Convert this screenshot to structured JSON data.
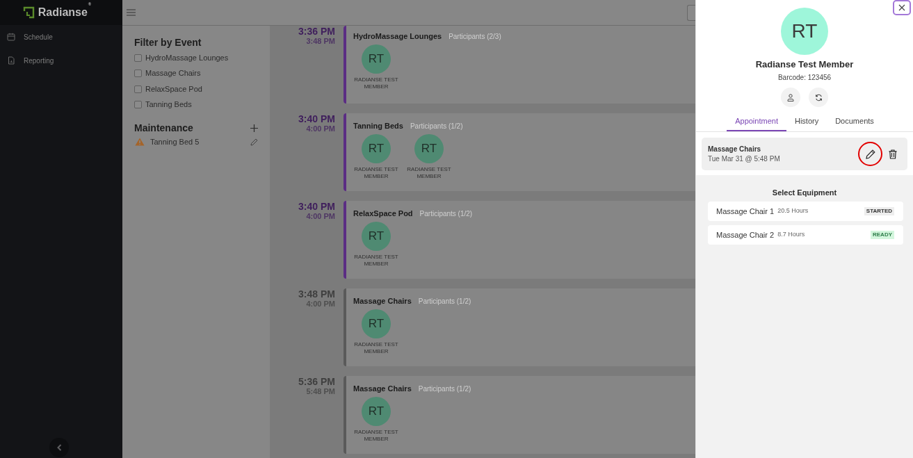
{
  "sidebar": {
    "logo": "Radianse$^{®}$",
    "items": [
      {
        "label": "Schedule",
        "selected": false
      },
      {
        "label": "Reporting",
        "selected": false
      }
    ]
  },
  "filter": {
    "title": "Filter by Event",
    "options": [
      {
        "label": "HydroMassage Lounges",
        "checked": false
      },
      {
        "label": "Massage Chairs",
        "checked": false
      },
      {
        "label": "RelaxSpace Pod",
        "checked": false
      },
      {
        "label": "Tanning Beds",
        "checked": false
      }
    ]
  },
  "maintenance": {
    "title": "Maintenance",
    "items": [
      {
        "label": "Tanning Bed 5"
      }
    ]
  },
  "schedule": [
    {
      "start": "3:36 PM",
      "end": "3:48 PM",
      "color": "#5b2d84",
      "title": "HydroMassage Lounges",
      "participants": "Participants (2/3)",
      "members": [
        {
          "initials": "RT",
          "name": "RADIANSE TEST MEMBER"
        }
      ]
    },
    {
      "start": "3:40 PM",
      "end": "4:00 PM",
      "color": "#5b2d84",
      "title": "Tanning Beds",
      "participants": "Participants (1/2)",
      "members": [
        {
          "initials": "RT",
          "name": "RADIANSE TEST MEMBER"
        },
        {
          "initials": "RT",
          "name": "RADIANSE TEST MEMBER"
        }
      ]
    },
    {
      "start": "3:40 PM",
      "end": "4:00 PM",
      "color": "#5b2d84",
      "title": "RelaxSpace Pod",
      "participants": "Participants (1/2)",
      "members": [
        {
          "initials": "RT",
          "name": "RADIANSE TEST MEMBER"
        }
      ]
    },
    {
      "start": "3:48 PM",
      "end": "4:00 PM",
      "color": "#5a5a5a",
      "title": "Massage Chairs",
      "participants": "Participants (1/2)",
      "members": [
        {
          "initials": "RT",
          "name": "RADIANSE TEST MEMBER"
        }
      ]
    },
    {
      "start": "5:36 PM",
      "end": "5:48 PM",
      "color": "#5a5a5a",
      "title": "Massage Chairs",
      "participants": "Participants (1/2)",
      "members": [
        {
          "initials": "RT",
          "name": "RADIANSE TEST MEMBER"
        }
      ]
    }
  ],
  "drawer": {
    "avatar": "RT",
    "name": "Radianse Test Member",
    "barcode": "Barcode: 123456",
    "tabs": [
      {
        "label": "Appointment",
        "selected": true
      },
      {
        "label": "History",
        "selected": false
      },
      {
        "label": "Documents",
        "selected": false
      }
    ],
    "appointment": {
      "title": "Massage Chairs",
      "when": "Tue Mar 31 @ 5:48 PM",
      "edit_highlighted": true
    },
    "equipment": {
      "title": "Select Equipment",
      "items": [
        {
          "name": "Massage Chair 1",
          "hours": "20.5 Hours",
          "status": "STARTED",
          "kind": "started"
        },
        {
          "name": "Massage Chair 2",
          "hours": "8.7 Hours",
          "status": "READY",
          "kind": "ready"
        }
      ]
    }
  }
}
